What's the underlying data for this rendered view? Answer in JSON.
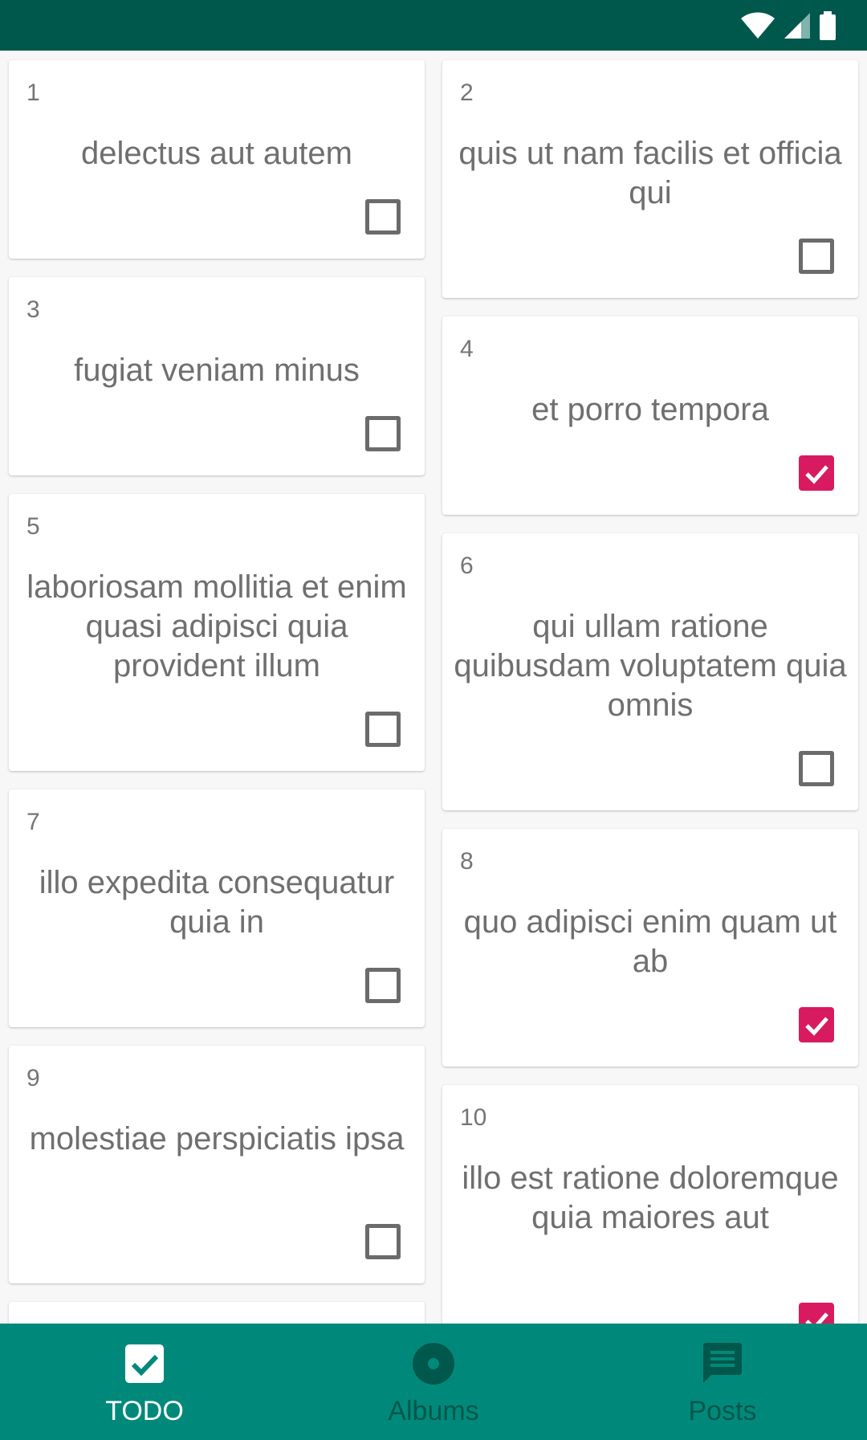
{
  "colors": {
    "status_bar": "#00574b",
    "bottom_nav": "#00897b",
    "checked": "#d81b60",
    "nav_active": "#ffffff",
    "nav_inactive": "#00574b"
  },
  "todos": [
    {
      "id": "1",
      "title": "delectus aut autem",
      "completed": false
    },
    {
      "id": "2",
      "title": "quis ut nam facilis et officia qui",
      "completed": false
    },
    {
      "id": "3",
      "title": "fugiat veniam minus",
      "completed": false
    },
    {
      "id": "4",
      "title": "et porro tempora",
      "completed": true
    },
    {
      "id": "5",
      "title": "laboriosam mollitia et enim quasi adipisci quia provident illum",
      "completed": false
    },
    {
      "id": "6",
      "title": "qui ullam ratione quibusdam voluptatem quia omnis",
      "completed": false
    },
    {
      "id": "7",
      "title": "illo expedita consequatur quia in",
      "completed": false
    },
    {
      "id": "8",
      "title": "quo adipisci enim quam ut ab",
      "completed": true
    },
    {
      "id": "9",
      "title": "molestiae perspiciatis ipsa",
      "completed": false
    },
    {
      "id": "10",
      "title": "illo est ratione doloremque quia maiores aut",
      "completed": true
    }
  ],
  "nav": {
    "items": [
      {
        "label": "TODO",
        "icon": "check-box-icon",
        "active": true
      },
      {
        "label": "Albums",
        "icon": "album-icon",
        "active": false
      },
      {
        "label": "Posts",
        "icon": "comment-icon",
        "active": false
      }
    ]
  }
}
